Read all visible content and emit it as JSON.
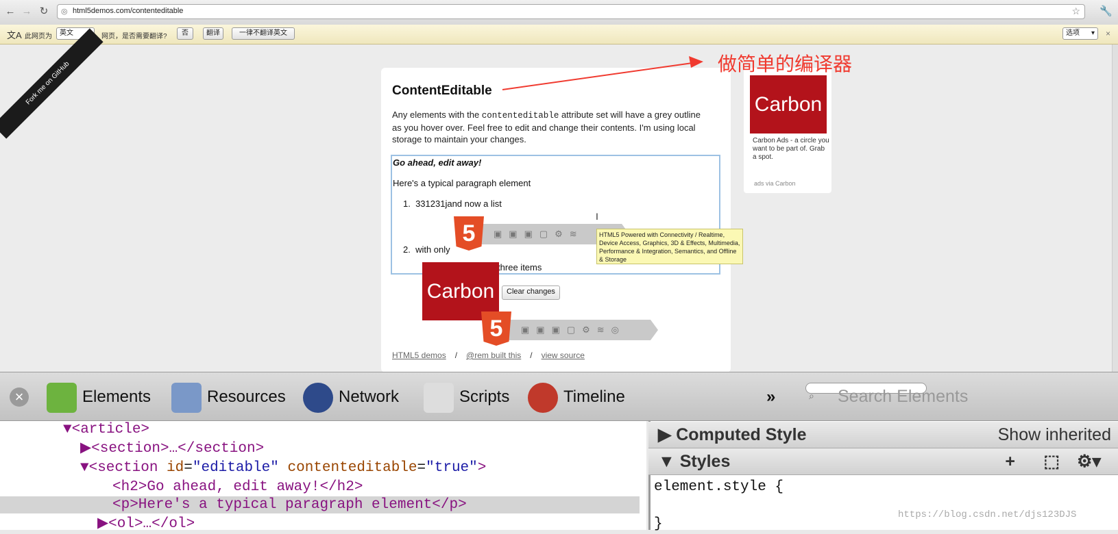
{
  "browser": {
    "url": "html5demos.com/contenteditable"
  },
  "translate_bar": {
    "page_lang_label": "此网页为",
    "lang_value": "英文",
    "question": "网页，是否需要翻译?",
    "no_label": "否",
    "translate_label": "翻译",
    "never_label": "一律不翻译英文",
    "options_label": "选项"
  },
  "page": {
    "ribbon_text": "Fork me on GitHub",
    "title": "ContentEditable",
    "intro_before": "Any elements with the ",
    "intro_code": "contenteditable",
    "intro_after": " attribute set will have a grey outline as you hover over. Feel free to edit and change their contents. I'm using local storage to maintain your changes.",
    "editable": {
      "heading": "Go ahead, edit away!",
      "paragraph": "Here's a typical paragraph element",
      "items": [
        "1.  331231jand now a list",
        "2.  with only",
        "3.  three items"
      ]
    },
    "clear_button": "Clear changes",
    "footer": {
      "link1": "HTML5 demos",
      "link2": "@rem built this",
      "link3": "view source",
      "sep": "/"
    },
    "tooltip": "HTML5 Powered with Connectivity / Realtime, Device Access, Graphics, 3D & Effects, Multimedia, Performance & Integration, Semantics, and Offline & Storage",
    "html5_badge": "5"
  },
  "ad": {
    "logo": "Carbon",
    "text": "Carbon Ads - a circle you want to be part of. Grab a spot.",
    "via": "ads via Carbon"
  },
  "annotation": "做简单的编译器",
  "devtools": {
    "tabs": [
      "Elements",
      "Resources",
      "Network",
      "Scripts",
      "Timeline"
    ],
    "more": "»",
    "search_placeholder": "Search Elements",
    "dom": {
      "l1": "▼<article>",
      "l2": "▶<section>…</section>",
      "l3_tag": "▼<section ",
      "l3_attr1": "id",
      "l3_val1": "\"editable\"",
      "l3_attr2": "contenteditable",
      "l3_val2": "\"true\"",
      "l4": "<h2>Go ahead, edit away!</h2>",
      "l5": "<p>Here's a typical paragraph element</p>",
      "l6": "▶<ol>…</ol>"
    },
    "computed_style": "Computed Style",
    "show_inherited": "Show inherited",
    "styles": "Styles",
    "element_style": "element.style {",
    "close_brace": "}"
  },
  "watermark": "https://blog.csdn.net/djs123DJS",
  "colors": {
    "annotation": "#f03a2f",
    "carbon": "#b3131b",
    "html5": "#e44d26"
  }
}
